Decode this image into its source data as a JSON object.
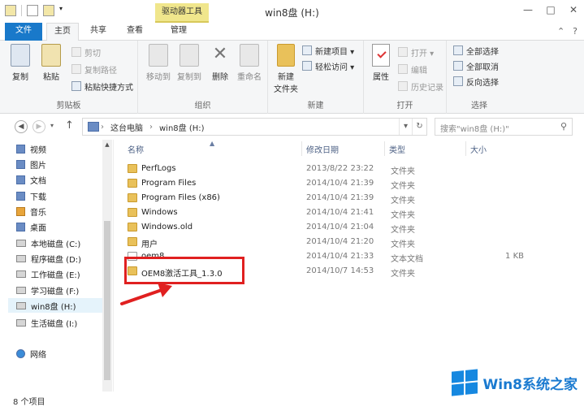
{
  "window": {
    "title": "win8盘 (H:)",
    "context_tab": "驱动器工具",
    "buttons": [
      "—",
      "□",
      "✕"
    ]
  },
  "tabs": {
    "file": "文件",
    "home": "主页",
    "share": "共享",
    "view": "查看",
    "manage": "管理"
  },
  "ribbon": {
    "clipboard": {
      "label": "剪贴板",
      "copy": "复制",
      "paste": "粘贴",
      "cut": "剪切",
      "copy_path": "复制路径",
      "paste_shortcut": "粘贴快捷方式"
    },
    "organize": {
      "label": "组织",
      "move_to": "移动到",
      "copy_to": "复制到",
      "delete": "删除",
      "rename": "重命名"
    },
    "new": {
      "label": "新建",
      "new_folder": "新建\n文件夹",
      "new_folder_l1": "新建",
      "new_folder_l2": "文件夹",
      "new_item": "新建项目 ▾",
      "easy_access": "轻松访问 ▾"
    },
    "open": {
      "label": "打开",
      "properties": "属性",
      "open": "打开 ▾",
      "edit": "编辑",
      "history": "历史记录"
    },
    "select": {
      "label": "选择",
      "select_all": "全部选择",
      "select_none": "全部取消",
      "invert": "反向选择"
    }
  },
  "address": {
    "segments": [
      "这台电脑",
      "win8盘 (H:)"
    ],
    "search_placeholder": "搜索\"win8盘 (H:)\""
  },
  "nav": {
    "items": [
      {
        "label": "视频",
        "icon": "video-icon"
      },
      {
        "label": "图片",
        "icon": "pictures-icon"
      },
      {
        "label": "文档",
        "icon": "documents-icon"
      },
      {
        "label": "下载",
        "icon": "downloads-icon"
      },
      {
        "label": "音乐",
        "icon": "music-icon"
      },
      {
        "label": "桌面",
        "icon": "desktop-icon"
      },
      {
        "label": "本地磁盘 (C:)",
        "icon": "drive-icon"
      },
      {
        "label": "程序磁盘 (D:)",
        "icon": "drive-icon"
      },
      {
        "label": "工作磁盘 (E:)",
        "icon": "drive-icon"
      },
      {
        "label": "学习磁盘 (F:)",
        "icon": "drive-icon"
      },
      {
        "label": "win8盘 (H:)",
        "icon": "drive-icon"
      },
      {
        "label": "生活磁盘 (I:)",
        "icon": "drive-icon"
      },
      {
        "label": "网络",
        "icon": "network-icon"
      }
    ]
  },
  "list": {
    "columns": {
      "name": "名称",
      "date": "修改日期",
      "type": "类型",
      "size": "大小"
    },
    "rows": [
      {
        "name": "PerfLogs",
        "date": "2013/8/22 23:22",
        "type": "文件夹",
        "size": ""
      },
      {
        "name": "Program Files",
        "date": "2014/10/4 21:39",
        "type": "文件夹",
        "size": ""
      },
      {
        "name": "Program Files (x86)",
        "date": "2014/10/4 21:39",
        "type": "文件夹",
        "size": ""
      },
      {
        "name": "Windows",
        "date": "2014/10/4 21:41",
        "type": "文件夹",
        "size": ""
      },
      {
        "name": "Windows.old",
        "date": "2014/10/4 21:04",
        "type": "文件夹",
        "size": ""
      },
      {
        "name": "用户",
        "date": "2014/10/4 21:20",
        "type": "文件夹",
        "size": ""
      },
      {
        "name": "oem8",
        "date": "2014/10/4 21:33",
        "type": "文本文档",
        "size": "1 KB"
      },
      {
        "name": "OEM8激活工具_1.3.0",
        "date": "2014/10/7 14:53",
        "type": "文件夹",
        "size": ""
      }
    ]
  },
  "status": {
    "count": "8 个项目"
  },
  "watermark": {
    "text": "Win8系统之家"
  },
  "colors": {
    "accent": "#1979ca",
    "highlight": "#e02020",
    "folder": "#e9c15a"
  }
}
